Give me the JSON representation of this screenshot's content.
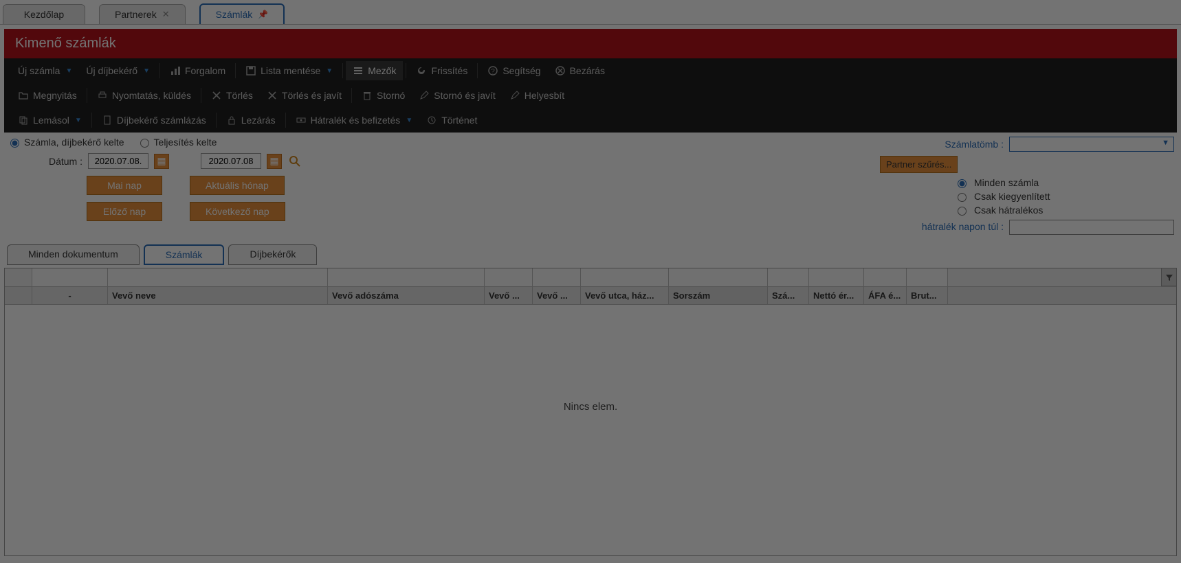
{
  "top_tabs": {
    "home": "Kezdőlap",
    "partners": "Partnerek",
    "invoices": "Számlák"
  },
  "page_title": "Kimenő számlák",
  "toolbar1": {
    "new_invoice": "Új számla",
    "new_proforma": "Új díjbekérő",
    "traffic": "Forgalom",
    "save_list": "Lista mentése",
    "fields": "Mezők",
    "refresh": "Frissítés",
    "help": "Segítség",
    "close": "Bezárás"
  },
  "toolbar2": {
    "open": "Megnyitás",
    "print_send": "Nyomtatás, küldés",
    "delete": "Törlés",
    "delete_fix": "Törlés és javít",
    "storno": "Stornó",
    "storno_fix": "Stornó és javít",
    "correct": "Helyesbít"
  },
  "toolbar3": {
    "copy": "Lemásol",
    "proforma_invoicing": "Díjbekérő számlázás",
    "close_item": "Lezárás",
    "arrears_payment": "Hátralék és befizetés",
    "history": "Történet"
  },
  "filter": {
    "radio_invoice_date": "Számla, díjbekérő kelte",
    "radio_fulfillment_date": "Teljesítés kelte",
    "date_label": "Dátum :",
    "date_from": "2020.07.08.",
    "date_to": "2020.07.08",
    "today": "Mai nap",
    "current_month": "Aktuális hónap",
    "prev_day": "Előző nap",
    "next_day": "Következő nap",
    "book_label": "Számlatömb :",
    "partner_filter": "Partner szűrés...",
    "all_invoices": "Minden számla",
    "only_settled": "Csak kiegyenlített",
    "only_arrears": "Csak hátralékos",
    "arrears_days_label": "hátralék napon túl :"
  },
  "doc_tabs": {
    "all": "Minden dokumentum",
    "invoices": "Számlák",
    "proformas": "Díjbekérők"
  },
  "grid": {
    "headers": {
      "dash": "-",
      "customer_name": "Vevő neve",
      "customer_tax": "Vevő adószáma",
      "customer_a": "Vevő ...",
      "customer_b": "Vevő ...",
      "customer_street": "Vevő utca, ház...",
      "serial": "Sorszám",
      "sz": "Szá...",
      "net": "Nettó ér...",
      "vat": "ÁFA é...",
      "gross": "Brut..."
    },
    "empty_message": "Nincs elem."
  }
}
